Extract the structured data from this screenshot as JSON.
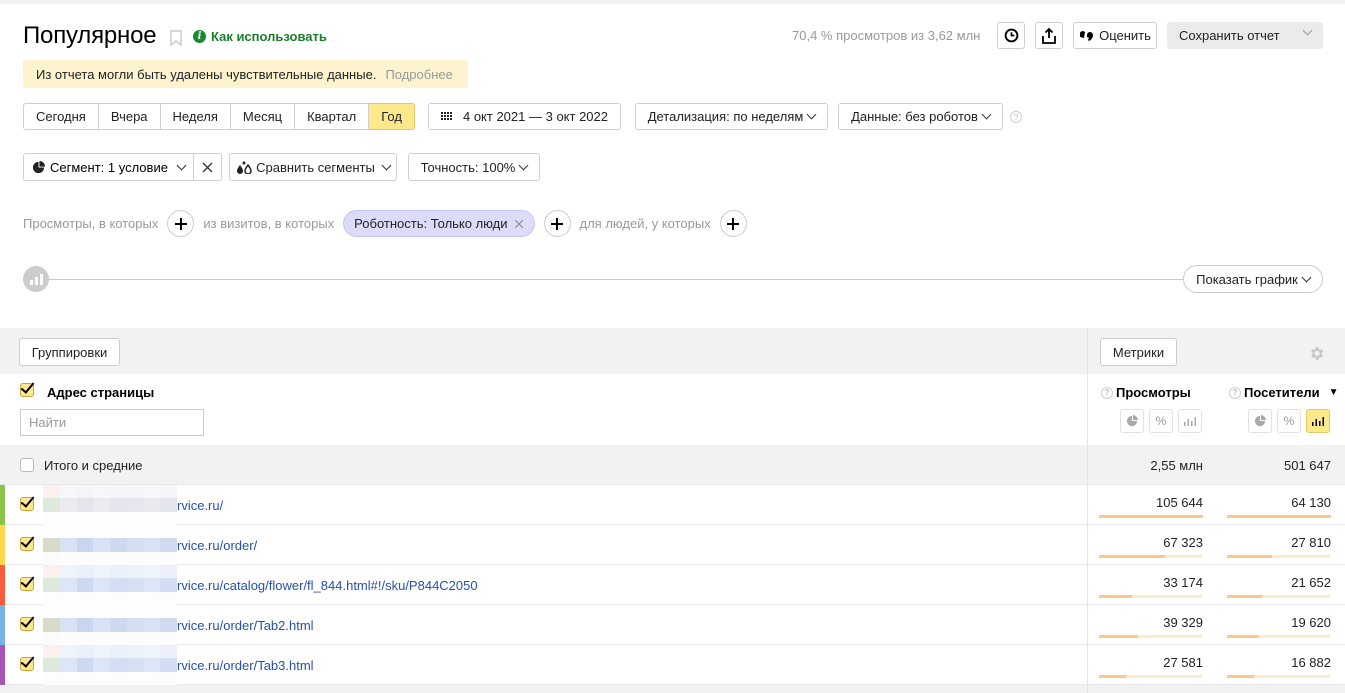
{
  "header": {
    "title": "Популярное",
    "how_to_use": "Как использовать",
    "warning_text": "Из отчета могли быть удалены чувствительные данные.",
    "warning_more": "Подробнее",
    "sampling_info": "70,4 % просмотров из 3,62 млн",
    "rate_label": "Оценить",
    "save_label": "Сохранить отчет"
  },
  "periods": {
    "items": [
      "Сегодня",
      "Вчера",
      "Неделя",
      "Месяц",
      "Квартал",
      "Год"
    ],
    "active": "Год"
  },
  "date_range": "4 окт 2021 — 3 окт 2022",
  "detail": "Детализация: по неделям",
  "data_filter": "Данные: без роботов",
  "segment": {
    "label": "Сегмент: 1 условие",
    "compare": "Сравнить сегменты",
    "accuracy": "Точность: 100%"
  },
  "conditions": {
    "views": "Просмотры, в которых",
    "visits": "из визитов, в которых",
    "chip": "Роботность: Только люди",
    "people": "для людей, у которых"
  },
  "graph": {
    "show_label": "Показать график"
  },
  "table": {
    "groupings_label": "Группировки",
    "metrics_label": "Метрики",
    "dimension_header": "Адрес страницы",
    "search_placeholder": "Найти",
    "metric_headers": [
      "Просмотры",
      "Посетители"
    ],
    "sort_indicator": "▼",
    "totals_label": "Итого и средние",
    "totals": [
      "2,55 млн",
      "501 647"
    ],
    "rows": [
      {
        "url": "rvice.ru/",
        "color": "#8bc34a",
        "views": "105 644",
        "visitors": "64 130",
        "views_share": 1.0,
        "visitors_share": 1.0
      },
      {
        "url": "rvice.ru/order/",
        "color": "#ffd54f",
        "views": "67 323",
        "visitors": "27 810",
        "views_share": 0.637,
        "visitors_share": 0.434
      },
      {
        "url": "rvice.ru/catalog/flower/fl_844.html#!/sku/P844C2050",
        "color": "#ff5a3c",
        "views": "33 174",
        "visitors": "21 652",
        "views_share": 0.314,
        "visitors_share": 0.338
      },
      {
        "url": "rvice.ru/order/Tab2.html",
        "color": "#74b4e8",
        "views": "39 329",
        "visitors": "19 620",
        "views_share": 0.372,
        "visitors_share": 0.306
      },
      {
        "url": "rvice.ru/order/Tab3.html",
        "color": "#a855b8",
        "views": "27 581",
        "visitors": "16 882",
        "views_share": 0.261,
        "visitors_share": 0.263
      }
    ]
  }
}
